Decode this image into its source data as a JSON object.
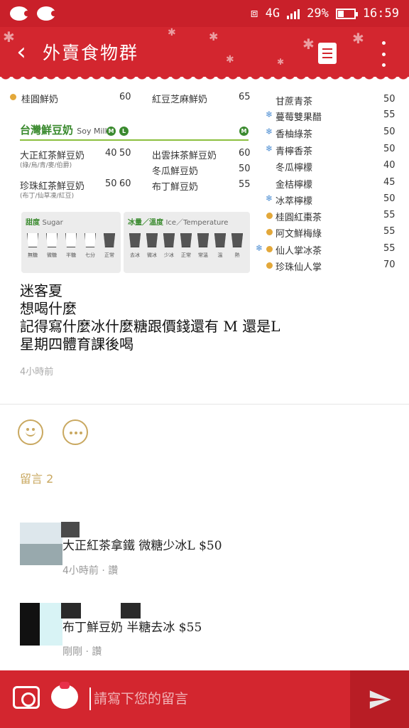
{
  "status_bar": {
    "network": "4G",
    "battery": "29%",
    "time": "16:59"
  },
  "header": {
    "title": "外賣食物群"
  },
  "menu": {
    "top_items": [
      {
        "name": "桂圓鮮奶",
        "price": "60"
      },
      {
        "name": "紅豆芝麻鮮奶",
        "price": "65"
      }
    ],
    "soy_title": "台灣鮮豆奶",
    "soy_title_en": "Soy Milk",
    "size_m": "M",
    "size_l": "L",
    "soy_items": [
      {
        "name": "大正紅茶鮮豆奶",
        "sub": "(綠/烏/青/麥/伯爵)",
        "price_m": "40",
        "price_l": "50"
      },
      {
        "name": "珍珠紅茶鮮豆奶",
        "sub": "(布丁/仙草凍/紅豆)",
        "price_m": "50",
        "price_l": "60"
      },
      {
        "name": "出雲抹茶鮮豆奶",
        "price": "60"
      },
      {
        "name": "冬瓜鮮豆奶",
        "price": "50"
      },
      {
        "name": "布丁鮮豆奶",
        "price": "55"
      }
    ],
    "sugar_title": "甜度",
    "sugar_title_en": "Sugar",
    "sugar_levels": [
      "無糖",
      "微糖",
      "半糖",
      "七分",
      "正常"
    ],
    "ice_title": "冰量／溫度",
    "ice_title_en": "Ice／Temperature",
    "ice_levels": [
      "去冰",
      "微冰",
      "少冰",
      "正常",
      "常溫",
      "溫",
      "熱"
    ],
    "right_items": [
      {
        "name": "甘蔗青茶",
        "price": "50"
      },
      {
        "name": "蔓莓雙果醋",
        "price": "55"
      },
      {
        "name": "香柚綠茶",
        "price": "50"
      },
      {
        "name": "青檸香茶",
        "price": "50"
      },
      {
        "name": "冬瓜檸檬",
        "price": "40"
      },
      {
        "name": "金桔檸檬",
        "price": "45"
      },
      {
        "name": "冰萃檸檬",
        "price": "50"
      },
      {
        "name": "桂圓紅棗茶",
        "price": "55"
      },
      {
        "name": "阿文鮮梅綠",
        "price": "55"
      },
      {
        "name": "仙人掌冰茶",
        "price": "55"
      },
      {
        "name": "珍珠仙人掌",
        "price": "70"
      }
    ]
  },
  "post": {
    "line1": "迷客夏",
    "line2": "想喝什麼",
    "line3": "記得寫什麼冰什麼糖跟價錢還有 M 還是L",
    "line4": "星期四體育課後喝",
    "time": "4小時前"
  },
  "comments_header": "留言 2",
  "comments": [
    {
      "text": "大正紅茶拿鐵 微糖少冰L $50",
      "meta": "4小時前 · 讚"
    },
    {
      "text": "布丁鮮豆奶 半糖去冰 $55",
      "meta": "剛剛 · 讚"
    }
  ],
  "composer": {
    "placeholder": "請寫下您的留言"
  },
  "colors": {
    "brand_red": "#d3262f",
    "accent_gold": "#c9a860",
    "soy_green": "#3a8a2e"
  },
  "icons": [
    "back-arrow-icon",
    "document-icon",
    "more-vertical-icon",
    "smile-icon",
    "comment-icon",
    "camera-icon",
    "sticker-icon",
    "send-icon"
  ]
}
